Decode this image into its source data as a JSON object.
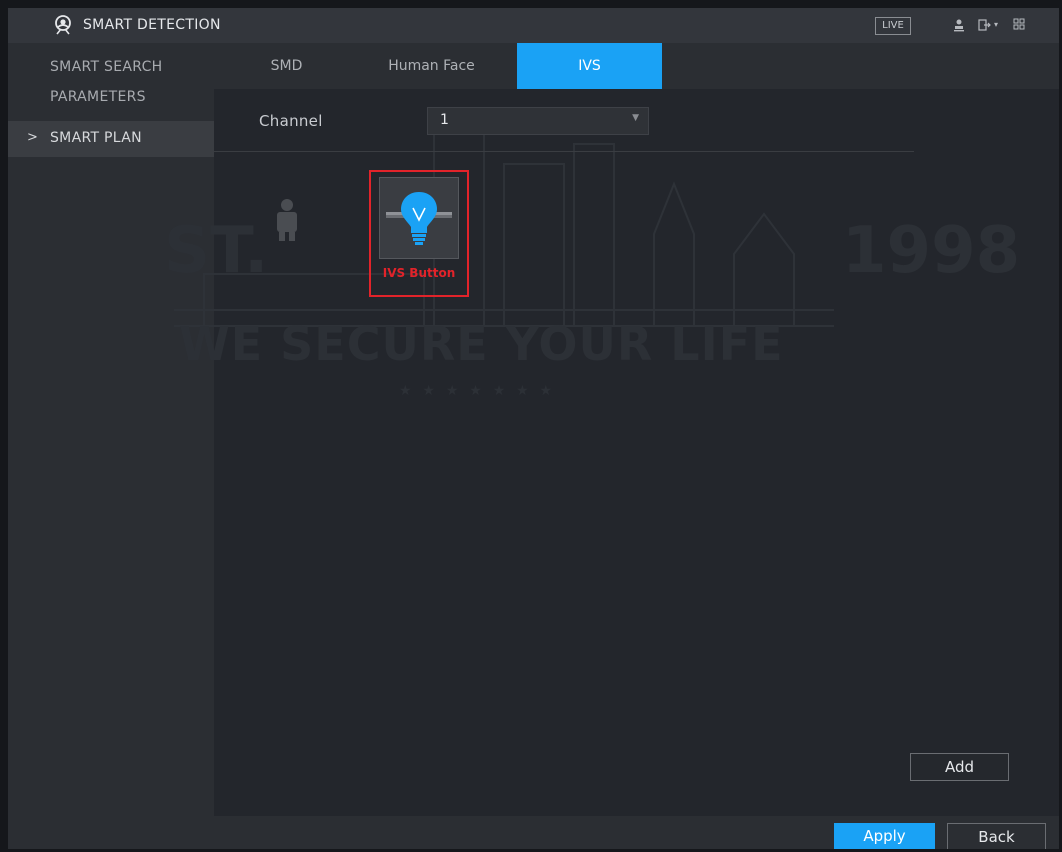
{
  "header": {
    "title": "SMART DETECTION",
    "live_label": "LIVE",
    "icons": [
      "user-icon",
      "logout-icon",
      "dropdown-caret-icon",
      "grid-menu-icon"
    ]
  },
  "sidebar": {
    "items": [
      {
        "label": "SMART SEARCH",
        "active": false
      },
      {
        "label": "PARAMETERS",
        "active": false
      },
      {
        "label": "SMART PLAN",
        "active": true
      }
    ],
    "active_marker": ">"
  },
  "tabs": [
    {
      "label": "SMD",
      "active": false
    },
    {
      "label": "Human Face",
      "active": false
    },
    {
      "label": "IVS",
      "active": true
    }
  ],
  "main": {
    "channel_label": "Channel",
    "channel_value": "1",
    "plans": [
      {
        "icon": "person-icon",
        "label": "",
        "highlighted": false
      },
      {
        "icon": "lightbulb-icon",
        "label": "IVS Button",
        "highlighted": true
      }
    ]
  },
  "watermark": {
    "left_text": "ST.",
    "right_text": "1998",
    "tagline": "WE SECURE YOUR LIFE",
    "stars": "★ ★ ★ ★ ★ ★ ★"
  },
  "footer": {
    "add_label": "Add",
    "apply_label": "Apply",
    "back_label": "Back"
  },
  "colors": {
    "accent": "#1aa2f5",
    "highlight_red": "#e2232a",
    "background": "#23262c"
  }
}
